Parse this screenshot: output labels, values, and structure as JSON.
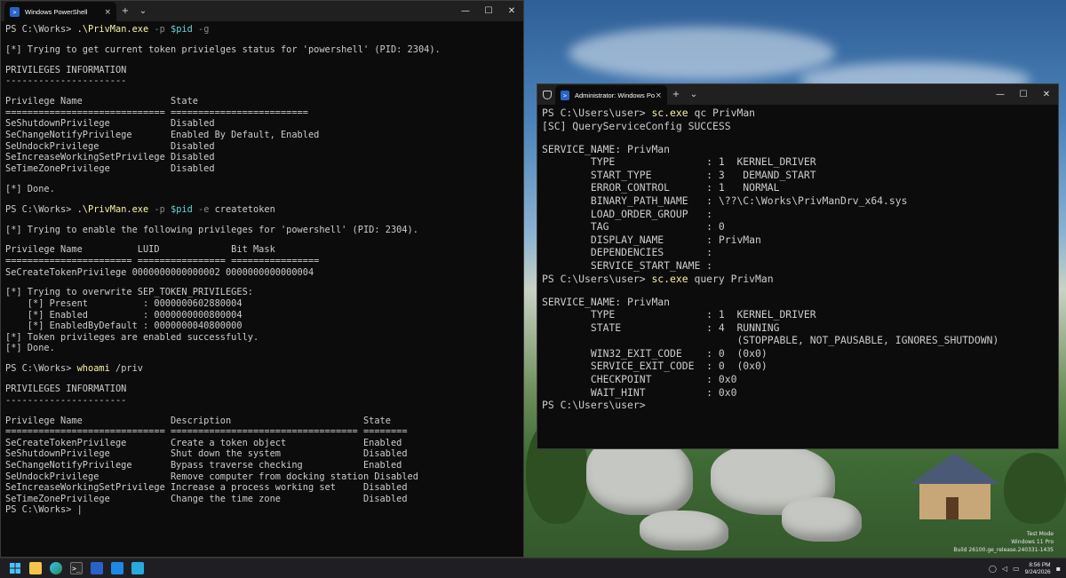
{
  "window1": {
    "tab_title": "Windows PowerShell",
    "lines": [
      [
        [
          "PS C:\\Works> ",
          "n"
        ],
        [
          ".\\PrivMan.exe",
          "c"
        ],
        [
          " -p",
          "p"
        ],
        [
          " $pid",
          "v"
        ],
        [
          " -g",
          "p"
        ]
      ],
      [
        [
          "",
          "n"
        ]
      ],
      [
        [
          "[*] Trying to get current token privielges status for 'powershell' (PID: 2304).",
          "n"
        ]
      ],
      [
        [
          "",
          "n"
        ]
      ],
      [
        [
          "PRIVILEGES INFORMATION",
          "n"
        ]
      ],
      [
        [
          "----------------------",
          "n"
        ]
      ],
      [
        [
          "",
          "n"
        ]
      ],
      [
        [
          "Privilege Name                State",
          "n"
        ]
      ],
      [
        [
          "============================= =========================",
          "n"
        ]
      ],
      [
        [
          "SeShutdownPrivilege           Disabled",
          "n"
        ]
      ],
      [
        [
          "SeChangeNotifyPrivilege       Enabled By Default, Enabled",
          "n"
        ]
      ],
      [
        [
          "SeUndockPrivilege             Disabled",
          "n"
        ]
      ],
      [
        [
          "SeIncreaseWorkingSetPrivilege Disabled",
          "n"
        ]
      ],
      [
        [
          "SeTimeZonePrivilege           Disabled",
          "n"
        ]
      ],
      [
        [
          "",
          "n"
        ]
      ],
      [
        [
          "[*] Done.",
          "n"
        ]
      ],
      [
        [
          "",
          "n"
        ]
      ],
      [
        [
          "PS C:\\Works> ",
          "n"
        ],
        [
          ".\\PrivMan.exe",
          "c"
        ],
        [
          " -p",
          "p"
        ],
        [
          " $pid",
          "v"
        ],
        [
          " -e",
          "p"
        ],
        [
          " createtoken",
          "n"
        ]
      ],
      [
        [
          "",
          "n"
        ]
      ],
      [
        [
          "[*] Trying to enable the following privileges for 'powershell' (PID: 2304).",
          "n"
        ]
      ],
      [
        [
          "",
          "n"
        ]
      ],
      [
        [
          "Privilege Name          LUID             Bit Mask",
          "n"
        ]
      ],
      [
        [
          "======================= ================ ================",
          "n"
        ]
      ],
      [
        [
          "SeCreateTokenPrivilege 0000000000000002 0000000000000004",
          "n"
        ]
      ],
      [
        [
          "",
          "n"
        ]
      ],
      [
        [
          "[*] Trying to overwrite SEP_TOKEN_PRIVILEGES:",
          "n"
        ]
      ],
      [
        [
          "    [*] Present          : 0000000602880004",
          "n"
        ]
      ],
      [
        [
          "    [*] Enabled          : 0000000000800004",
          "n"
        ]
      ],
      [
        [
          "    [*] EnabledByDefault : 0000000040800000",
          "n"
        ]
      ],
      [
        [
          "[*] Token privileges are enabled successfully.",
          "n"
        ]
      ],
      [
        [
          "[*] Done.",
          "n"
        ]
      ],
      [
        [
          "",
          "n"
        ]
      ],
      [
        [
          "PS C:\\Works> ",
          "n"
        ],
        [
          "whoami",
          "c"
        ],
        [
          " /priv",
          "n"
        ]
      ],
      [
        [
          "",
          "n"
        ]
      ],
      [
        [
          "PRIVILEGES INFORMATION",
          "n"
        ]
      ],
      [
        [
          "----------------------",
          "n"
        ]
      ],
      [
        [
          "",
          "n"
        ]
      ],
      [
        [
          "Privilege Name                Description                        State",
          "n"
        ]
      ],
      [
        [
          "============================= ================================== ========",
          "n"
        ]
      ],
      [
        [
          "SeCreateTokenPrivilege        Create a token object              Enabled",
          "n"
        ]
      ],
      [
        [
          "SeShutdownPrivilege           Shut down the system               Disabled",
          "n"
        ]
      ],
      [
        [
          "SeChangeNotifyPrivilege       Bypass traverse checking           Enabled",
          "n"
        ]
      ],
      [
        [
          "SeUndockPrivilege             Remove computer from docking station Disabled",
          "n"
        ]
      ],
      [
        [
          "SeIncreaseWorkingSetPrivilege Increase a process working set     Disabled",
          "n"
        ]
      ],
      [
        [
          "SeTimeZonePrivilege           Change the time zone               Disabled",
          "n"
        ]
      ],
      [
        [
          "PS C:\\Works> ",
          "n"
        ],
        [
          "|",
          "n"
        ]
      ]
    ]
  },
  "window2": {
    "tab_title": "Administrator: Windows Powe",
    "lines": [
      [
        [
          "PS C:\\Users\\user> ",
          "n"
        ],
        [
          "sc.exe",
          "c"
        ],
        [
          " qc PrivMan",
          "n"
        ]
      ],
      [
        [
          "[SC] QueryServiceConfig SUCCESS",
          "n"
        ]
      ],
      [
        [
          "",
          "n"
        ]
      ],
      [
        [
          "SERVICE_NAME: PrivMan",
          "n"
        ]
      ],
      [
        [
          "        TYPE               : 1  KERNEL_DRIVER",
          "n"
        ]
      ],
      [
        [
          "        START_TYPE         : 3   DEMAND_START",
          "n"
        ]
      ],
      [
        [
          "        ERROR_CONTROL      : 1   NORMAL",
          "n"
        ]
      ],
      [
        [
          "        BINARY_PATH_NAME   : \\??\\C:\\Works\\PrivManDrv_x64.sys",
          "n"
        ]
      ],
      [
        [
          "        LOAD_ORDER_GROUP   :",
          "n"
        ]
      ],
      [
        [
          "        TAG                : 0",
          "n"
        ]
      ],
      [
        [
          "        DISPLAY_NAME       : PrivMan",
          "n"
        ]
      ],
      [
        [
          "        DEPENDENCIES       :",
          "n"
        ]
      ],
      [
        [
          "        SERVICE_START_NAME :",
          "n"
        ]
      ],
      [
        [
          "PS C:\\Users\\user> ",
          "n"
        ],
        [
          "sc.exe",
          "c"
        ],
        [
          " query PrivMan",
          "n"
        ]
      ],
      [
        [
          "",
          "n"
        ]
      ],
      [
        [
          "SERVICE_NAME: PrivMan",
          "n"
        ]
      ],
      [
        [
          "        TYPE               : 1  KERNEL_DRIVER",
          "n"
        ]
      ],
      [
        [
          "        STATE              : 4  RUNNING",
          "n"
        ]
      ],
      [
        [
          "                                (STOPPABLE, NOT_PAUSABLE, IGNORES_SHUTDOWN)",
          "n"
        ]
      ],
      [
        [
          "        WIN32_EXIT_CODE    : 0  (0x0)",
          "n"
        ]
      ],
      [
        [
          "        SERVICE_EXIT_CODE  : 0  (0x0)",
          "n"
        ]
      ],
      [
        [
          "        CHECKPOINT         : 0x0",
          "n"
        ]
      ],
      [
        [
          "        WAIT_HINT          : 0x0",
          "n"
        ]
      ],
      [
        [
          "PS C:\\Users\\user>",
          "n"
        ]
      ]
    ]
  },
  "titlebar": {
    "new_tab": "+",
    "dropdown": "⌄",
    "close_tab": "×",
    "minimize": "—",
    "maximize": "☐",
    "close": "✕"
  },
  "watermark": {
    "line1": "Test Mode",
    "line2": "Windows 11 Pro",
    "line3": "Build 26100.ge_release.240331-1435"
  },
  "taskbar": {
    "icons": [
      "windows-start-icon",
      "file-explorer-icon",
      "edge-icon",
      "terminal-icon",
      "app-icon",
      "app-icon-2",
      "app-icon-3"
    ],
    "time": "8:56 PM",
    "date": "9/24/2026"
  },
  "colors": {
    "console_bg": "#0c0c0c",
    "console_fg": "#cccccc",
    "command": "#f9f1a5",
    "param": "#8a8a8a",
    "variable": "#61d6d6"
  }
}
